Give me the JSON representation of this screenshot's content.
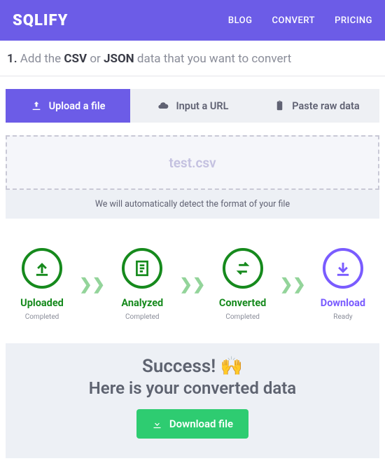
{
  "header": {
    "logo": "SQLIFY",
    "nav": [
      "BLOG",
      "CONVERT",
      "PRICING"
    ]
  },
  "step_title": {
    "num": "1.",
    "pre": " Add the ",
    "b1": "CSV",
    "mid": " or ",
    "b2": "JSON",
    "post": " data that you want to convert"
  },
  "tabs": [
    {
      "label": "Upload a file",
      "icon": "upload-icon"
    },
    {
      "label": "Input a URL",
      "icon": "cloud-icon"
    },
    {
      "label": "Paste raw data",
      "icon": "paste-icon"
    }
  ],
  "dropzone": {
    "filename": "test.csv"
  },
  "hint": "We will automatically detect the format of your file",
  "steps": [
    {
      "label": "Uploaded",
      "status": "Completed",
      "color": "green",
      "icon": "upload"
    },
    {
      "label": "Analyzed",
      "status": "Completed",
      "color": "green",
      "icon": "doc"
    },
    {
      "label": "Converted",
      "status": "Completed",
      "color": "green",
      "icon": "swap"
    },
    {
      "label": "Download",
      "status": "Ready",
      "color": "purple",
      "icon": "download"
    }
  ],
  "success": {
    "title": "Success! 🙌",
    "subtitle": "Here is your converted data",
    "button": "Download file"
  }
}
